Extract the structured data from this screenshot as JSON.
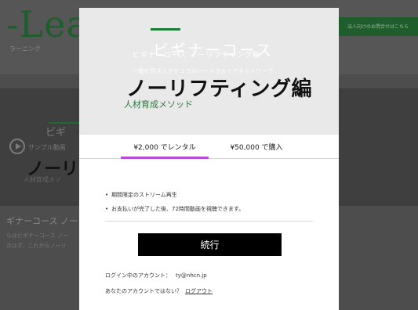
{
  "background": {
    "logo": "-Lea",
    "subtitle": "ラーニング",
    "right_button_text": "法人向けのお問合せはこちら",
    "hero_title_small": "ビギ",
    "hero_title_large": "ノーリ",
    "hero_caption": "人材育成メソ",
    "play_text": "サンプル動画",
    "heading": "ギナーコース ノー",
    "paragraph1": "らはビギナーコース ノー",
    "paragraph2": "のはず、これからノーリ"
  },
  "modal": {
    "thumbnail": {
      "subtitle_small": "ビギナーコース",
      "subtitle_large": "ビギナーコース",
      "subtitle_tail": "ノーリフティング編",
      "organization": "一般社団法人ナチュラルハートフルケアネットワーク",
      "title": "ノーリフティング編",
      "caption": "人材育成メソッド"
    },
    "tabs": [
      {
        "label": "¥2,000 でレンタル",
        "selected": true
      },
      {
        "label": "¥50,000 で購入",
        "selected": false
      }
    ],
    "bullets": [
      "期間限定のストリーム再生",
      "お支払いが完了した後、72時間動画を視聴できます。"
    ],
    "continue_label": "続行",
    "account": {
      "label": "ログイン中のアカウント：",
      "email": "ty@nhcn.jp",
      "not_you": "あなたのアカウントではない？",
      "logout": "ログアウト"
    },
    "accent_color": "#b84bd6",
    "brand_green": "#1a7d36"
  }
}
